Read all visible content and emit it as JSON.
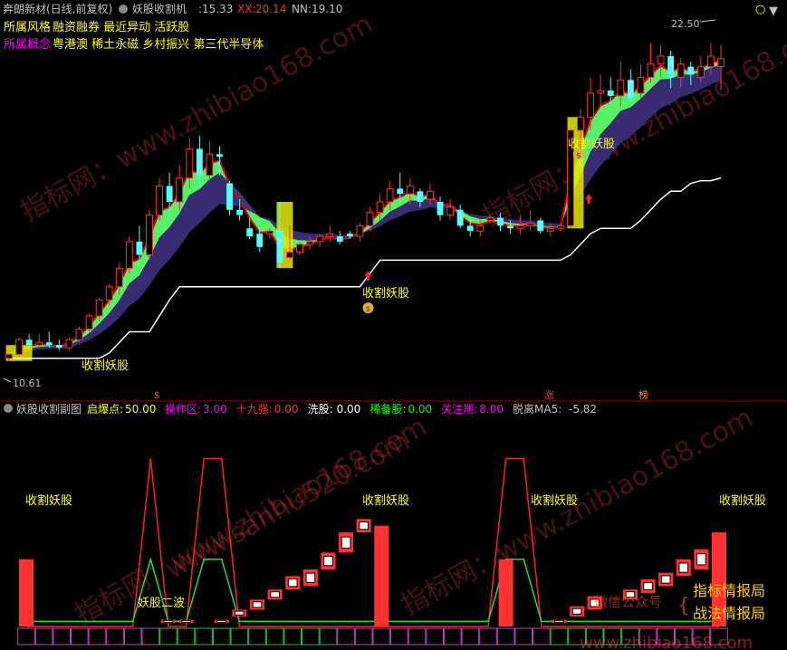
{
  "colors": {
    "bg": "#000000",
    "up": "#ff3232",
    "down": "#54ffff",
    "white": "#ffffff",
    "yellow": "#ffff00",
    "green": "#00ff00",
    "lime": "#5aff6e",
    "purple": "#3c2d78",
    "magenta": "#ff00ff",
    "divider": "#a00000",
    "label": "#c0c0c0",
    "bull": "#ff5050",
    "bear": "#00e000"
  },
  "top_header": {
    "title": "奔朗新材(日线,前复权)",
    "indicator": "妖股收割机",
    "indicator_suffix": ":15.33",
    "xx_label": "XX:",
    "xx_value": "20.14",
    "nn_label": "NN:",
    "nn_value": "19.10"
  },
  "info": {
    "style_label": "所属风格",
    "style_text": "融资融券 最近异动 活跃股",
    "concept_label": "所属概念",
    "concept_text": "粤港澳 稀土永磁 乡村振兴 第三代半导体"
  },
  "price_labels": {
    "high": "22.50",
    "low": "10.61"
  },
  "signal_text": "收割妖股",
  "markers": {
    "m1": "$",
    "m2": "涨",
    "m3": "榜"
  },
  "bottom_header": {
    "name": "妖股收割副图",
    "items": [
      {
        "label": "启爆点:",
        "value": "50.00",
        "color": "#ffff00",
        "vcolor": "#ffff00"
      },
      {
        "label": "操作区:",
        "value": "3.00",
        "color": "#ff00ff",
        "vcolor": "#ff00ff"
      },
      {
        "label": "十九强:",
        "value": "0.00",
        "color": "#ff3232",
        "vcolor": "#ff3232"
      },
      {
        "label": "洗股:",
        "value": "0.00",
        "color": "#ffffff",
        "vcolor": "#ffffff"
      },
      {
        "label": "稀备股:",
        "value": "0.00",
        "color": "#00ff00",
        "vcolor": "#00ff00"
      },
      {
        "label": "关注期:",
        "value": "8.00",
        "color": "#ff00ff",
        "vcolor": "#ff00ff"
      },
      {
        "label": "脱离MA5:",
        "value": "-5.82",
        "color": "#c0c0c0",
        "vcolor": "#c0c0c0"
      }
    ]
  },
  "bottom_labels": {
    "wave2": "妖股二波"
  },
  "watermark": {
    "w1": "指标网：www.zhibiao168.com",
    "w2": "www.sanhu520.com",
    "w3": "微信公众号",
    "w4": "指标情报局",
    "w5": "战法情报局",
    "w6": "www.zhibiao168.com"
  },
  "chart_data": [
    {
      "type": "candlestick",
      "title": "奔朗新材(日线,前复权)",
      "ylim": [
        9.5,
        23.5
      ],
      "series": [
        {
          "name": "K线",
          "ohlc": [
            [
              10.6,
              10.8,
              10.5,
              10.75
            ],
            [
              10.75,
              11.4,
              10.7,
              11.3
            ],
            [
              11.3,
              11.5,
              11.0,
              11.1
            ],
            [
              11.1,
              11.5,
              11.0,
              11.2
            ],
            [
              11.2,
              11.6,
              11.0,
              11.1
            ],
            [
              11.1,
              11.3,
              10.9,
              11.0
            ],
            [
              11.0,
              11.4,
              10.9,
              11.3
            ],
            [
              11.3,
              11.8,
              11.2,
              11.7
            ],
            [
              11.7,
              12.3,
              11.6,
              12.2
            ],
            [
              12.2,
              12.9,
              12.0,
              12.8
            ],
            [
              12.8,
              13.4,
              12.6,
              13.3
            ],
            [
              13.3,
              14.2,
              13.0,
              14.0
            ],
            [
              14.0,
              15.2,
              13.8,
              15.0
            ],
            [
              15.0,
              15.6,
              14.2,
              14.5
            ],
            [
              14.5,
              16.2,
              14.3,
              16.0
            ],
            [
              16.0,
              17.4,
              15.8,
              17.1
            ],
            [
              17.1,
              17.6,
              15.9,
              16.5
            ],
            [
              16.5,
              17.9,
              16.2,
              17.4
            ],
            [
              17.4,
              18.9,
              17.0,
              18.5
            ],
            [
              18.5,
              19.0,
              17.1,
              17.5
            ],
            [
              17.5,
              18.8,
              17.3,
              18.3
            ],
            [
              18.3,
              18.6,
              17.5,
              18.2
            ],
            [
              17.2,
              17.3,
              16.0,
              16.2
            ],
            [
              16.2,
              16.6,
              15.8,
              16.0
            ],
            [
              15.5,
              15.9,
              15.1,
              15.2
            ],
            [
              15.3,
              15.5,
              14.6,
              14.8
            ],
            [
              15.3,
              15.5,
              15.1,
              15.4
            ],
            [
              15.4,
              16.5,
              14.0,
              14.2
            ],
            [
              14.4,
              15.6,
              14.3,
              14.6
            ],
            [
              14.6,
              15.0,
              14.5,
              14.9
            ],
            [
              14.9,
              15.2,
              14.7,
              15.0
            ],
            [
              15.0,
              15.3,
              14.8,
              15.2
            ],
            [
              15.2,
              15.6,
              15.0,
              15.3
            ],
            [
              15.2,
              15.4,
              14.9,
              15.0
            ],
            [
              15.3,
              15.4,
              15.1,
              15.2
            ],
            [
              15.2,
              15.7,
              15.0,
              15.6
            ],
            [
              15.6,
              16.3,
              15.4,
              16.1
            ],
            [
              16.1,
              16.8,
              15.8,
              16.5
            ],
            [
              16.5,
              17.3,
              16.2,
              17.0
            ],
            [
              17.0,
              17.6,
              16.5,
              16.8
            ],
            [
              16.8,
              17.4,
              16.4,
              17.1
            ],
            [
              16.9,
              17.0,
              16.3,
              16.5
            ],
            [
              16.6,
              17.2,
              16.4,
              16.9
            ],
            [
              16.5,
              16.7,
              15.8,
              16.0
            ],
            [
              16.0,
              16.6,
              15.8,
              16.3
            ],
            [
              16.2,
              16.4,
              15.5,
              15.6
            ],
            [
              15.6,
              15.9,
              15.2,
              15.4
            ],
            [
              15.4,
              15.8,
              15.2,
              15.6
            ],
            [
              15.8,
              16.0,
              15.7,
              15.9
            ],
            [
              15.9,
              16.1,
              15.4,
              15.6
            ],
            [
              15.6,
              15.8,
              15.3,
              15.5
            ],
            [
              15.5,
              16.0,
              15.3,
              15.6
            ],
            [
              15.6,
              16.2,
              15.4,
              15.7
            ],
            [
              15.8,
              15.9,
              15.3,
              15.4
            ],
            [
              15.4,
              15.7,
              15.2,
              15.5
            ],
            [
              15.5,
              15.7,
              15.4,
              15.6
            ],
            [
              15.6,
              19.2,
              15.5,
              19.2
            ],
            [
              19.2,
              20.0,
              18.2,
              19.7
            ],
            [
              19.7,
              21.2,
              19.2,
              20.6
            ],
            [
              20.6,
              21.3,
              20.1,
              20.7
            ],
            [
              20.7,
              21.2,
              20.2,
              20.5
            ],
            [
              20.5,
              21.8,
              20.1,
              21.1
            ],
            [
              21.1,
              21.5,
              20.3,
              20.4
            ],
            [
              20.6,
              21.7,
              20.4,
              21.2
            ],
            [
              21.2,
              22.5,
              21.0,
              21.7
            ],
            [
              21.7,
              22.4,
              21.2,
              22.0
            ],
            [
              22.0,
              22.2,
              20.8,
              21.2
            ],
            [
              21.2,
              21.9,
              20.8,
              21.7
            ],
            [
              21.6,
              21.8,
              20.9,
              21.3
            ],
            [
              21.2,
              22.0,
              21.0,
              21.6
            ],
            [
              21.6,
              22.5,
              21.3,
              22.0
            ],
            [
              21.6,
              22.4,
              20.7,
              21.9
            ]
          ]
        },
        {
          "name": "白线",
          "values": [
            10.6,
            10.6,
            10.6,
            10.6,
            10.6,
            10.6,
            10.6,
            10.6,
            10.6,
            10.6,
            10.8,
            11.2,
            11.6,
            11.6,
            11.6,
            12.2,
            12.8,
            13.3,
            13.3,
            13.3,
            13.3,
            13.3,
            13.3,
            13.3,
            13.3,
            13.3,
            13.3,
            13.3,
            13.3,
            13.3,
            13.3,
            13.3,
            13.3,
            13.3,
            13.3,
            13.3,
            13.8,
            14.3,
            14.3,
            14.3,
            14.3,
            14.3,
            14.3,
            14.3,
            14.3,
            14.3,
            14.3,
            14.3,
            14.3,
            14.3,
            14.3,
            14.3,
            14.3,
            14.3,
            14.3,
            14.3,
            14.5,
            14.9,
            15.3,
            15.5,
            15.5,
            15.5,
            15.5,
            15.8,
            16.2,
            16.6,
            16.9,
            16.9,
            17.2,
            17.3,
            17.3,
            17.4
          ]
        }
      ]
    },
    {
      "type": "bar",
      "title": "妖股收割副图",
      "ylim": [
        0,
        62
      ],
      "series": [
        {
          "name": "启爆点",
          "values": [
            0,
            0,
            0,
            0,
            0,
            0,
            0,
            50,
            0,
            0,
            50,
            50,
            0,
            0,
            0,
            0,
            0,
            0,
            0,
            0,
            0,
            0,
            0,
            0,
            0,
            0,
            0,
            50,
            50,
            0,
            0,
            0,
            0,
            0,
            0,
            0,
            0,
            0,
            0,
            0
          ]
        },
        {
          "name": "副图柱",
          "ohlc": [
            [
              0,
              20,
              0,
              20
            ],
            [
              0,
              0,
              0,
              0
            ],
            [
              0,
              0,
              0,
              0
            ],
            [
              0,
              0,
              0,
              0
            ],
            [
              0,
              0,
              0,
              0
            ],
            [
              0,
              0,
              0,
              0
            ],
            [
              0,
              0,
              0,
              0
            ],
            [
              0,
              0,
              0,
              0
            ],
            [
              1,
              2,
              1,
              2
            ],
            [
              1,
              2,
              1,
              2
            ],
            [
              0,
              0,
              0,
              0
            ],
            [
              1,
              2,
              1,
              2
            ],
            [
              3,
              5,
              3,
              5
            ],
            [
              5,
              8,
              5,
              8
            ],
            [
              8,
              11,
              8,
              11
            ],
            [
              11,
              15,
              11,
              15
            ],
            [
              12,
              17,
              12,
              17
            ],
            [
              17,
              22,
              17,
              22
            ],
            [
              22,
              28,
              22,
              28
            ],
            [
              28,
              32,
              28,
              32
            ],
            [
              0,
              30,
              0,
              30
            ],
            [
              0,
              0,
              0,
              0
            ],
            [
              0,
              0,
              0,
              0
            ],
            [
              0,
              0,
              0,
              0
            ],
            [
              0,
              0,
              0,
              0
            ],
            [
              0,
              0,
              0,
              0
            ],
            [
              0,
              0,
              0,
              0
            ],
            [
              0,
              20,
              0,
              20
            ],
            [
              0,
              0,
              0,
              0
            ],
            [
              0,
              0,
              0,
              0
            ],
            [
              1,
              2,
              1,
              2
            ],
            [
              3,
              6,
              3,
              6
            ],
            [
              5,
              9,
              5,
              9
            ],
            [
              0,
              0,
              0,
              0
            ],
            [
              8,
              11,
              8,
              11
            ],
            [
              10,
              14,
              10,
              14
            ],
            [
              12,
              16,
              12,
              16
            ],
            [
              15,
              20,
              15,
              20
            ],
            [
              17,
              23,
              17,
              23
            ],
            [
              0,
              28,
              0,
              28
            ]
          ]
        }
      ]
    }
  ]
}
